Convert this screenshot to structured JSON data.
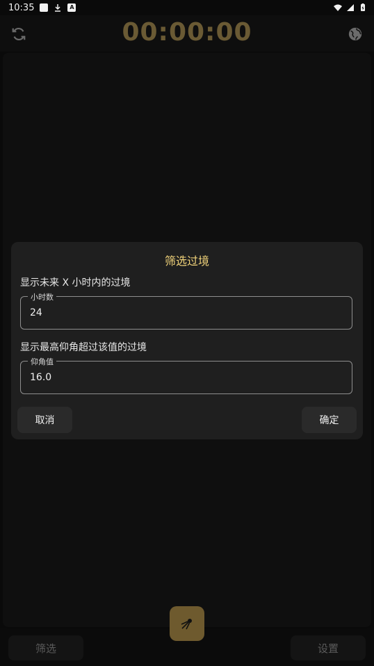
{
  "status_bar": {
    "time": "10:35"
  },
  "header": {
    "timer": "00:00:00"
  },
  "dialog": {
    "title": "筛选过境",
    "hours_label": "显示未来 X 小时内的过境",
    "hours_field_label": "小时数",
    "hours_value": "24",
    "elevation_label": "显示最高仰角超过该值的过境",
    "elevation_field_label": "仰角值",
    "elevation_value": "16.0",
    "cancel": "取消",
    "confirm": "确定"
  },
  "bottom_nav": {
    "filter": "筛选",
    "settings": "设置"
  },
  "icons": {
    "refresh": "refresh-icon",
    "globe": "globe-icon",
    "satellite": "satellite-icon"
  },
  "colors": {
    "accent": "#f1d37a",
    "timer": "#6a5a34",
    "fab": "#6e5a2e",
    "dialog_bg": "#1f1f1f"
  }
}
